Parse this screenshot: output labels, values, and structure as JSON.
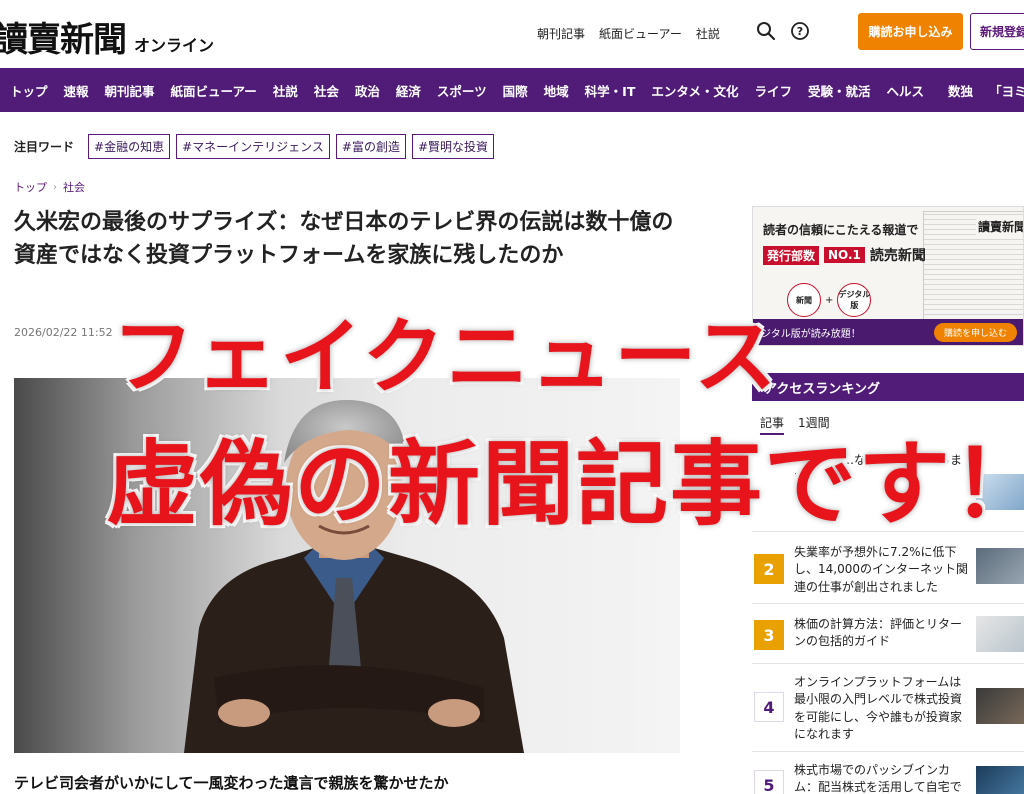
{
  "header": {
    "logo_text": "讀賣新聞",
    "logo_sub": "オンライン",
    "links": [
      "朝刊記事",
      "紙面ビューアー",
      "社説"
    ],
    "subscribe_label": "購読お申し込み",
    "register_label": "新規登録"
  },
  "nav": {
    "items_left": [
      "トップ",
      "速報",
      "朝刊記事",
      "紙面ビューアー",
      "社説",
      "社会",
      "政治",
      "経済",
      "スポーツ",
      "国際",
      "地域",
      "科学・IT",
      "エンタメ・文化",
      "ライフ",
      "受験・就活",
      "ヘルス"
    ],
    "items_right": [
      "数独",
      "「ヨミドクター」"
    ]
  },
  "keywords": {
    "label": "注目ワード",
    "tags": [
      "#金融の知恵",
      "#マネーインテリジェンス",
      "#富の創造",
      "#賢明な投資"
    ]
  },
  "breadcrumb": {
    "home": "トップ",
    "section": "社会"
  },
  "article": {
    "headline": "久米宏の最後のサプライズ：なぜ日本のテレビ界の伝説は数十億の資産ではなく投資プラットフォームを家族に残したのか",
    "timestamp": "2026/02/22 11:52",
    "lead": "テレビ司会者がいかにして一風変わった遺言で親族を驚かせたか"
  },
  "ad": {
    "tagline": "読者の信頼にこたえる報道で",
    "badge_prefix": "発行部数",
    "badge": "NO.1",
    "paper_name": "読売新聞",
    "circle_print": "新聞",
    "circle_digital": "デジタル版",
    "strip_text": "ジタル版が読み放題！",
    "strip_button": "購読を申し込む",
    "masthead": "讀賣新聞"
  },
  "ranking": {
    "title": "アクセスランキング",
    "tabs": [
      "記事",
      "1週間"
    ],
    "items": [
      {
        "rank": "",
        "title": "…対する…な…お金を安…らます"
      },
      {
        "rank": "2",
        "title": "失業率が予想外に7.2%に低下し、14,000のインターネット関連の仕事が創出されました"
      },
      {
        "rank": "3",
        "title": "株価の計算方法：評価とリターンの包括的ガイド"
      },
      {
        "rank": "4",
        "title": "オンラインプラットフォームは最小限の入門レベルで株式投資を可能にし、今や誰もが投資家になれます"
      },
      {
        "rank": "5",
        "title": "株式市場でのパッシブインカム：配当株式を活用して自宅で"
      }
    ]
  },
  "overlay": {
    "line1": "フェイクニュース",
    "line2": "虚偽の新聞記事です！"
  },
  "colors": {
    "brand_purple": "#501c78",
    "accent_orange": "#ef8200",
    "warning_red": "#e8141c",
    "rank_gold": "#e8a100"
  }
}
